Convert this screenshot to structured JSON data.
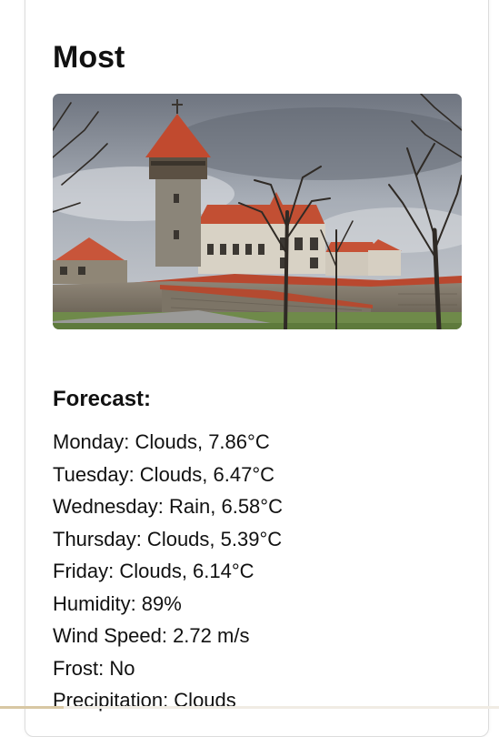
{
  "city": {
    "name": "Most"
  },
  "photo": {
    "subject": "castle-photo"
  },
  "forecast": {
    "heading": "Forecast:",
    "days": [
      {
        "text": "Monday: Clouds, 7.86°C"
      },
      {
        "text": "Tuesday: Clouds, 6.47°C"
      },
      {
        "text": "Wednesday: Rain, 6.58°C"
      },
      {
        "text": "Thursday: Clouds, 5.39°C"
      },
      {
        "text": "Friday: Clouds, 6.14°C"
      }
    ],
    "humidity": "Humidity: 89%",
    "wind_speed": "Wind Speed: 2.72 m/s",
    "frost": "Frost: No",
    "precipitation": "Precipitation: Clouds"
  }
}
